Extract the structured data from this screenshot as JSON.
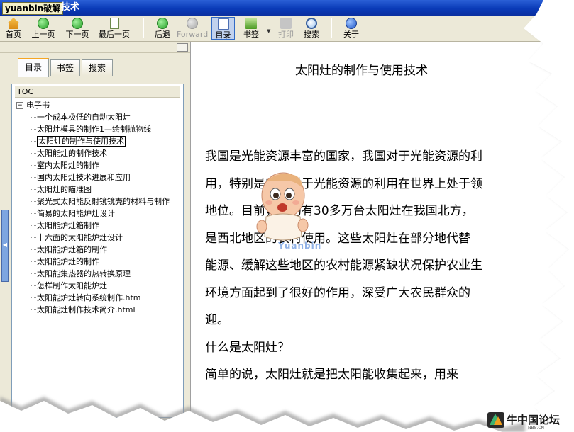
{
  "window": {
    "title_badge": "yuanbin破解",
    "title_rest": "技术"
  },
  "toolbar": {
    "home": "首页",
    "prev": "上一页",
    "next": "下一页",
    "last": "最后一页",
    "back": "后退",
    "forward": "Forward",
    "toc": "目录",
    "bookmark": "书签",
    "print": "打印",
    "search": "搜索",
    "about": "关于"
  },
  "sidebar": {
    "tabs": [
      "目录",
      "书签",
      "搜索"
    ],
    "tree_header": "TOC",
    "root_label": "电子书",
    "root_toggle": "−",
    "items": [
      "一个成本极低的自动太阳灶",
      "太阳灶模具的制作1—绘制抛物线",
      "太阳灶的制作与使用技术",
      "太阳能灶的制作技术",
      "室内太阳灶的制作",
      "国内太阳灶技术进展和应用",
      "太阳灶的瞄准图",
      "聚光式太阳能反射镜镜壳的材料与制作",
      "简易的太阳能炉灶设计",
      "太阳能炉灶箱制作",
      "十六面的太阳能炉灶设计",
      "太阳能炉灶箱的制作",
      "太阳能炉灶的制作",
      "太阳能集热器的热转换原理",
      "怎样制作太阳能炉灶",
      "太阳能炉灶转向系统制作.htm",
      "太阳能灶制作技术简介.html"
    ],
    "selected_index": 2
  },
  "document": {
    "title": "太阳灶的制作与使用技术",
    "lines": [
      "我国是光能资源丰富的国家，我国对于光能资源的利",
      "用，特别是农村对于光能资源的利用在世界上处于领",
      "地位。目前，大约有30多万台太阳灶在我国北方，",
      "是西北地区的农村使用。这些太阳灶在部分地代替",
      "能源、缓解这些地区的农村能源紧缺状况保护农业生",
      "环境方面起到了很好的作用，深受广大农民群众的",
      "迎。",
      "什么是太阳灶？",
      "简单的说，太阳灶就是把太阳能收集起来，用来"
    ]
  },
  "overlay": {
    "watermark": "Yuanbin",
    "logo_text": "牛中国论坛",
    "logo_sub": "NB5.CN"
  },
  "colors": {
    "titlebar": "#0a3bb8",
    "toolbar_bg": "#ece9d8",
    "tab_highlight": "#f5a623",
    "pane_border": "#7f9db9"
  }
}
